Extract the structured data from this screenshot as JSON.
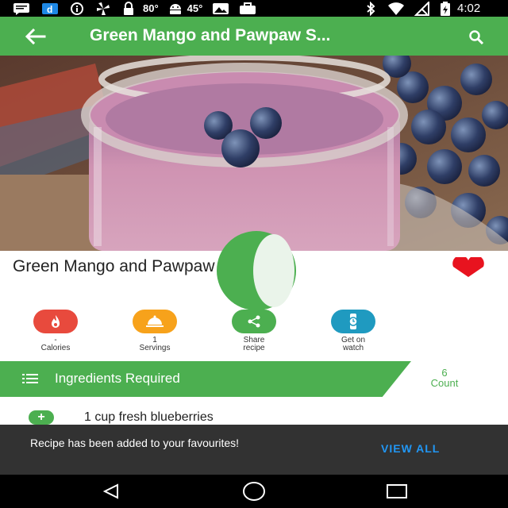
{
  "status_bar": {
    "temp1": "80°",
    "temp2": "45°",
    "time": "4:02",
    "icons": [
      "message-icon",
      "d-app-icon",
      "info-icon",
      "fan-icon",
      "lock-icon",
      "android-icon",
      "photo-icon",
      "briefcase-icon",
      "bluetooth-icon",
      "wifi-icon",
      "no-signal-icon",
      "battery-charging-icon"
    ]
  },
  "app_bar": {
    "title": "Green Mango and Pawpaw S...",
    "back_icon": "arrow-left-icon",
    "search_icon": "search-icon",
    "color": "#4CAF50"
  },
  "recipe": {
    "title": "Green Mango and Pawpaw Smoothie",
    "favorite_icon": "heart-icon",
    "favorite_color": "#E8131F"
  },
  "actions": [
    {
      "value": "-",
      "label": "Calories",
      "icon": "flame-icon",
      "color": "#E84A3D"
    },
    {
      "value": "1",
      "label": "Servings",
      "icon": "cloche-icon",
      "color": "#F7A21B"
    },
    {
      "value": "Share",
      "label": "recipe",
      "icon": "share-icon",
      "color": "#4CAF50"
    },
    {
      "value": "Get on",
      "label": "watch",
      "icon": "watch-icon",
      "color": "#1F9AC0"
    }
  ],
  "ingredients": {
    "title": "Ingredients Required",
    "count_value": "6",
    "count_label": "Count",
    "items": [
      {
        "text": "1 cup fresh blueberries"
      }
    ]
  },
  "snackbar": {
    "message": "Recipe has been added to your favourites!",
    "action": "VIEW ALL"
  },
  "nav_bar": {
    "icons": [
      "back-triangle-icon",
      "home-circle-icon",
      "recents-square-icon"
    ]
  }
}
